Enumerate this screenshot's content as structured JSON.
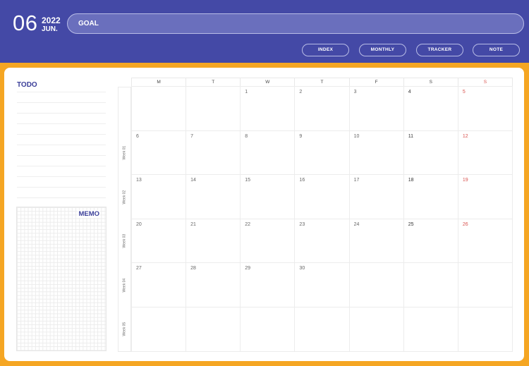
{
  "header": {
    "month_number": "06",
    "year": "2022",
    "month_name": "JUN.",
    "goal_label": "GOAL",
    "goal_value": "",
    "nav": [
      "INDEX",
      "MONTHLY",
      "TRACKER",
      "NOTE"
    ]
  },
  "todo": {
    "title": "TODO",
    "line_count": 11
  },
  "memo": {
    "title": "MEMO"
  },
  "calendar": {
    "day_headers": [
      "M",
      "T",
      "W",
      "T",
      "F",
      "S",
      "S"
    ],
    "week_labels": [
      "Week 01",
      "Week 02",
      "Week 03",
      "Week 04",
      "Week 05"
    ],
    "weeks": [
      [
        "",
        "",
        "1",
        "2",
        "3",
        "4",
        "5"
      ],
      [
        "6",
        "7",
        "8",
        "9",
        "10",
        "11",
        "12"
      ],
      [
        "13",
        "14",
        "15",
        "16",
        "17",
        "18",
        "19"
      ],
      [
        "20",
        "21",
        "22",
        "23",
        "24",
        "25",
        "26"
      ],
      [
        "27",
        "28",
        "29",
        "30",
        "",
        "",
        ""
      ],
      [
        "",
        "",
        "",
        "",
        "",
        "",
        ""
      ]
    ],
    "colors": {
      "sunday": "#d9534f",
      "saturday": "#333333",
      "weekday": "#666666"
    }
  },
  "colors": {
    "header_bg": "#4449a6",
    "frame_bg": "#f5a623",
    "accent_text": "#3b3f99"
  }
}
